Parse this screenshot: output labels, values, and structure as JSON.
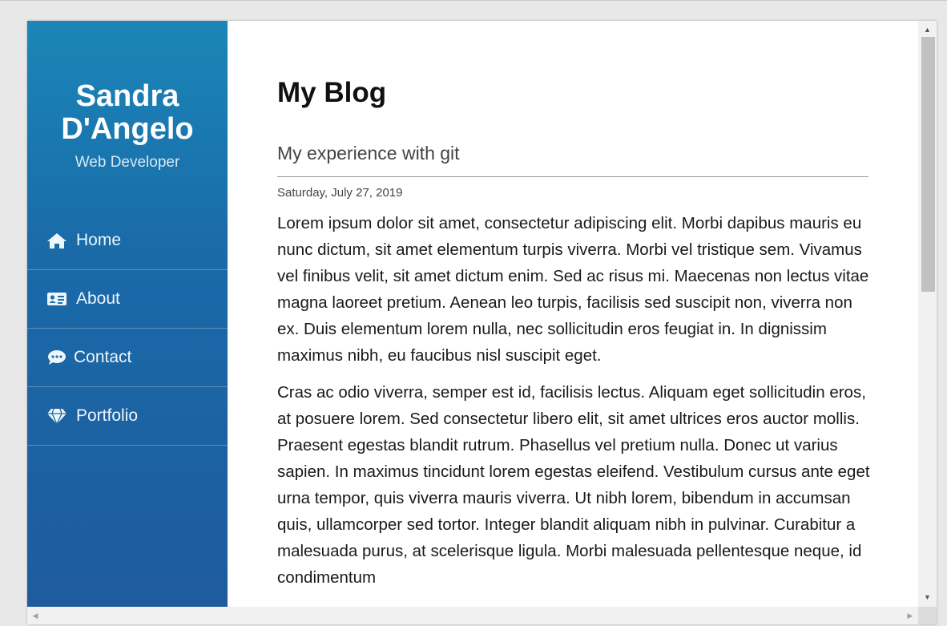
{
  "profile": {
    "name": "Sandra D'Angelo",
    "role": "Web Developer"
  },
  "nav": {
    "items": [
      {
        "label": "Home",
        "icon": "home-icon"
      },
      {
        "label": "About",
        "icon": "id-card-icon"
      },
      {
        "label": "Contact",
        "icon": "comment-dots-icon"
      },
      {
        "label": "Portfolio",
        "icon": "gem-icon"
      }
    ]
  },
  "blog": {
    "title": "My Blog",
    "post": {
      "title": "My experience with git",
      "date": "Saturday, July 27, 2019",
      "paragraphs": [
        "Lorem ipsum dolor sit amet, consectetur adipiscing elit. Morbi dapibus mauris eu nunc dictum, sit amet elementum turpis viverra. Morbi vel tristique sem. Vivamus vel finibus velit, sit amet dictum enim. Sed ac risus mi. Maecenas non lectus vitae magna laoreet pretium. Aenean leo turpis, facilisis sed suscipit non, viverra non ex. Duis elementum lorem nulla, nec sollicitudin eros feugiat in. In dignissim maximus nibh, eu faucibus nisl suscipit eget.",
        "Cras ac odio viverra, semper est id, facilisis lectus. Aliquam eget sollicitudin eros, at posuere lorem. Sed consectetur libero elit, sit amet ultrices eros auctor mollis. Praesent egestas blandit rutrum. Phasellus vel pretium nulla. Donec ut varius sapien. In maximus tincidunt lorem egestas eleifend. Vestibulum cursus ante eget urna tempor, quis viverra mauris viverra. Ut nibh lorem, bibendum in accumsan quis, ullamcorper sed tortor. Integer blandit aliquam nibh in pulvinar. Curabitur a malesuada purus, at scelerisque ligula. Morbi malesuada pellentesque neque, id condimentum"
      ]
    }
  },
  "colors": {
    "sidebar_top": "#1b86b8",
    "sidebar_bottom": "#1e5b9e",
    "text": "#1a1a1a"
  }
}
